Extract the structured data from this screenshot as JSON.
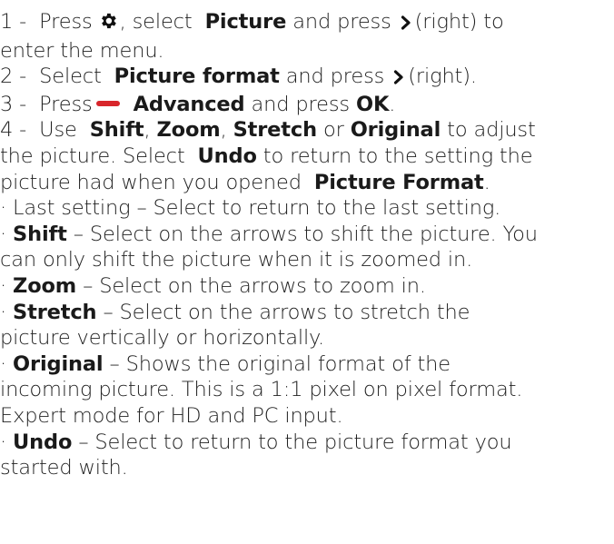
{
  "steps": {
    "s1": {
      "num": "1 -",
      "press": "Press",
      "comma_select": ", select",
      "picture": "Picture",
      "and_press": "and press",
      "right_enter": "(right) to",
      "line2": "enter the menu."
    },
    "s2": {
      "num": "2 -",
      "select": "Select",
      "picture_format": "Picture format",
      "and_press": "and press",
      "right": "(right)."
    },
    "s3": {
      "num": "3 -",
      "press": "Press",
      "advanced": "Advanced",
      "and_press": "and press",
      "ok": "OK",
      "period": "."
    },
    "s4": {
      "num": "4 -",
      "use": "Use",
      "shift": "Shift",
      "comma1": ",",
      "zoom": "Zoom",
      "comma2": ",",
      "stretch": "Stretch",
      "or": "or",
      "original": "Original",
      "to_adjust": "to adjust",
      "line2a": "the picture. Select",
      "undo": "Undo",
      "line2b": "to return to the setting the",
      "line3a": "picture had when you opened",
      "picture_format": "Picture Format",
      "line3b": "."
    }
  },
  "bullets": {
    "last": {
      "text": "· Last setting – Select to return to the last setting."
    },
    "shift": {
      "dot": "·",
      "kw": "Shift",
      "l1": "– Select on the arrows to shift the picture. You",
      "l2": "can only shift the picture when it is zoomed in."
    },
    "zoom": {
      "dot": "·",
      "kw": "Zoom",
      "l1": "– Select on the arrows to zoom in."
    },
    "stretch": {
      "dot": "·",
      "kw": "Stretch",
      "l1": "– Select on the arrows to stretch the",
      "l2": "picture vertically or horizontally."
    },
    "original": {
      "dot": "·",
      "kw": "Original",
      "l1": "– Shows the original format of the",
      "l2": "incoming picture. This is a 1:1 pixel on pixel format.",
      "l3": "Expert mode for HD and PC input."
    },
    "undo": {
      "dot": "·",
      "kw": "Undo",
      "l1": "– Select to return to the picture format you",
      "l2": "started with."
    }
  },
  "icons": {
    "settings": "gear-icon",
    "right": "chevron-right-icon",
    "red_key": "red-key-icon"
  },
  "colors": {
    "text": "#222222",
    "red_key": "#d8262b"
  }
}
